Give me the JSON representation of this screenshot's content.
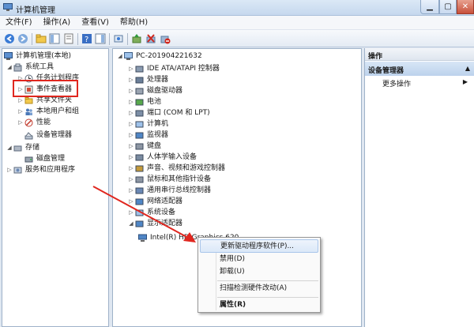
{
  "window": {
    "title": "计算机管理"
  },
  "menubar": {
    "items": [
      "文件(F)",
      "操作(A)",
      "查看(V)",
      "帮助(H)"
    ]
  },
  "left_tree": {
    "root": "计算机管理(本地)",
    "system_tools": "系统工具",
    "task_scheduler": "任务计划程序",
    "event_viewer": "事件查看器",
    "shared_folders": "共享文件夹",
    "local_users": "本地用户和组",
    "performance": "性能",
    "device_manager": "设备管理器",
    "storage": "存储",
    "disk_management": "磁盘管理",
    "services": "服务和应用程序"
  },
  "device_tree": {
    "computer": "PC-201904221632",
    "categories": [
      "IDE ATA/ATAPI 控制器",
      "处理器",
      "磁盘驱动器",
      "电池",
      "端口 (COM 和 LPT)",
      "计算机",
      "监视器",
      "键盘",
      "人体学输入设备",
      "声音、视频和游戏控制器",
      "鼠标和其他指针设备",
      "通用串行总线控制器",
      "网络适配器",
      "系统设备",
      "显示适配器"
    ],
    "display_child": "Intel(R) HD Graphics 620"
  },
  "actions": {
    "header": "操作",
    "section": "设备管理器",
    "more": "更多操作"
  },
  "context_menu": {
    "update_driver": "更新驱动程序软件(P)...",
    "disable": "禁用(D)",
    "uninstall": "卸载(U)",
    "scan": "扫描检测硬件改动(A)",
    "properties": "属性(R)"
  },
  "colors": {
    "highlight_box": "#e0271f",
    "arrow": "#e0271f"
  }
}
